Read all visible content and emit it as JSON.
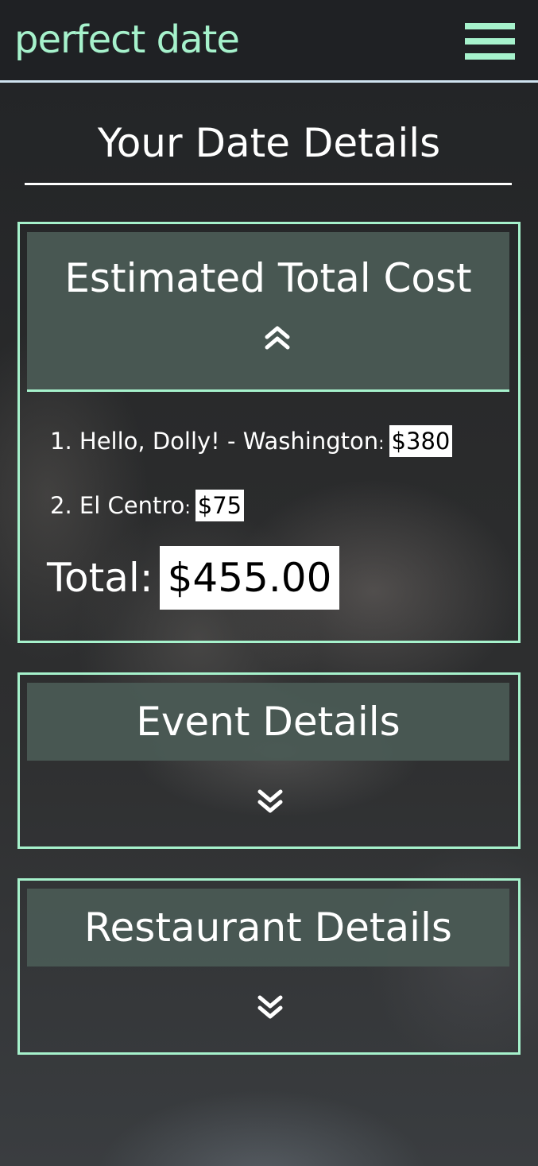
{
  "header": {
    "brand": "perfect date",
    "menu_icon": "hamburger-menu-icon"
  },
  "page": {
    "title": "Your Date Details"
  },
  "cost_card": {
    "title": "Estimated Total Cost",
    "toggle_icon": "chevron-double-up-icon",
    "items": [
      {
        "label": "1. Hello, Dolly! - Washington",
        "separator": ":",
        "price": "$380"
      },
      {
        "label": "2. El Centro",
        "separator": ":",
        "price": "$75"
      }
    ],
    "total_label": "Total:",
    "total_value": "$455.00"
  },
  "event_card": {
    "title": "Event Details",
    "toggle_icon": "chevron-double-down-icon"
  },
  "restaurant_card": {
    "title": "Restaurant Details",
    "toggle_icon": "chevron-double-down-icon"
  },
  "colors": {
    "accent": "#a6f2cc",
    "navbar_bg": "#1f2124",
    "card_header_bg": "#4a5a54",
    "navbar_border": "#cfe3f0"
  }
}
